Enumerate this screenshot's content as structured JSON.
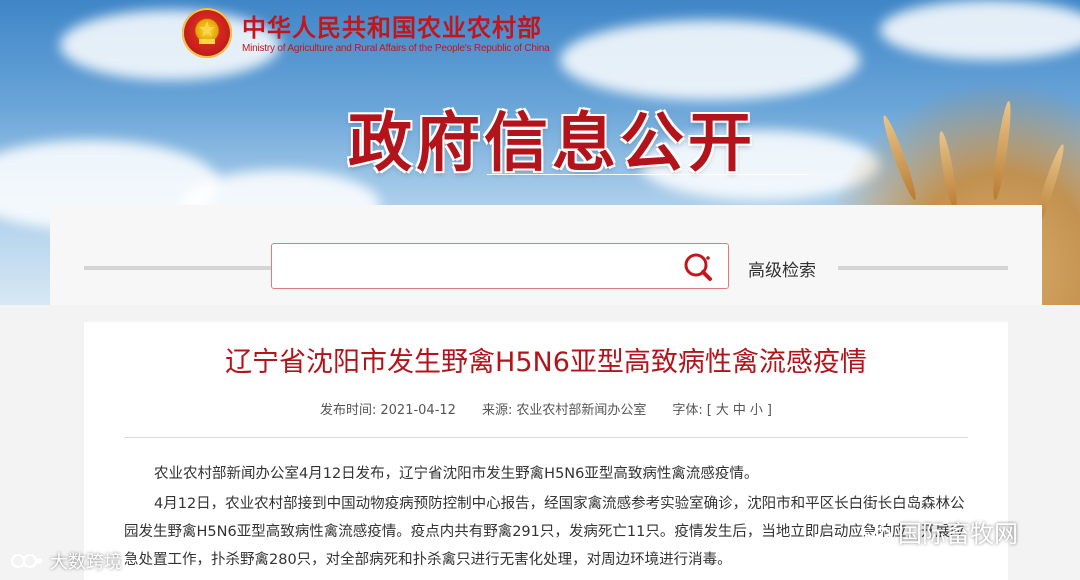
{
  "header": {
    "logo_cn": "中华人民共和国农业农村部",
    "logo_en": "Ministry of Agriculture and Rural Affairs of the People's Republic of China",
    "banner_title": "政府信息公开",
    "emblem_icon": "national-emblem-icon"
  },
  "search": {
    "placeholder": "",
    "value": "",
    "advanced_label": "高级检索",
    "icon": "search-icon"
  },
  "article": {
    "title": "辽宁省沈阳市发生野禽H5N6亚型高致病性禽流感疫情",
    "meta": {
      "date_label": "发布时间:",
      "date": "2021-04-12",
      "source_label": "来源:",
      "source": "农业农村部新闻办公室",
      "fontsize_label": "字体:",
      "fontsize_open": "[",
      "fontsize_large": "大",
      "fontsize_medium": "中",
      "fontsize_small": "小",
      "fontsize_close": "]"
    },
    "paragraphs": [
      "农业农村部新闻办公室4月12日发布，辽宁省沈阳市发生野禽H5N6亚型高致病性禽流感疫情。",
      "4月12日，农业农村部接到中国动物疫病预防控制中心报告，经国家禽流感参考实验室确诊，沈阳市和平区长白街长白岛森林公园发生野禽H5N6亚型高致病性禽流感疫情。疫点内共有野禽291只，发病死亡11只。疫情发生后，当地立即启动应急响应，开展应急处置工作，扑杀野禽280只，对全部病死和扑杀禽只进行无害化处理，对周边环境进行消毒。"
    ]
  },
  "watermarks": {
    "left_text": "大数跨境",
    "right_text": "国际畜牧网"
  },
  "colors": {
    "brand_red": "#b3141b",
    "search_border": "#e07b7b",
    "text": "#333333"
  }
}
